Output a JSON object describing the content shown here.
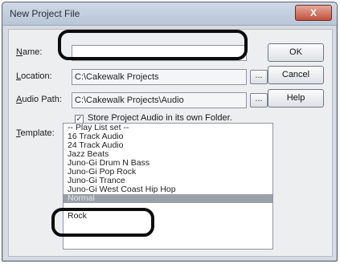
{
  "window": {
    "title": "New Project File",
    "close_symbol": "X"
  },
  "fields": {
    "name": {
      "label_u": "N",
      "label_rest": "ame:",
      "value": ""
    },
    "location": {
      "label_u": "L",
      "label_rest": "ocation:",
      "value": "C:\\Cakewalk Projects"
    },
    "audio_path": {
      "label_u": "A",
      "label_rest": "udio Path:",
      "value": "C:\\Cakewalk Projects\\Audio"
    }
  },
  "browse_label": "...",
  "checkbox": {
    "label": "Store Project Audio in its own Folder.",
    "checked": true,
    "mark": "✓"
  },
  "buttons": {
    "ok": "OK",
    "cancel": "Cancel",
    "help": "Help"
  },
  "template": {
    "label_u": "T",
    "label_rest": "emplate:",
    "items": [
      "-- Play List set --",
      "16 Track Audio",
      "24 Track Audio",
      "Jazz Beats",
      "Juno-Gi Drum N Bass",
      "Juno-Gi Pop Rock",
      "Juno-Gi Trance",
      "Juno-Gi West Coast Hip Hop",
      "Normal",
      "",
      "Rock"
    ],
    "selected_index": 8
  }
}
